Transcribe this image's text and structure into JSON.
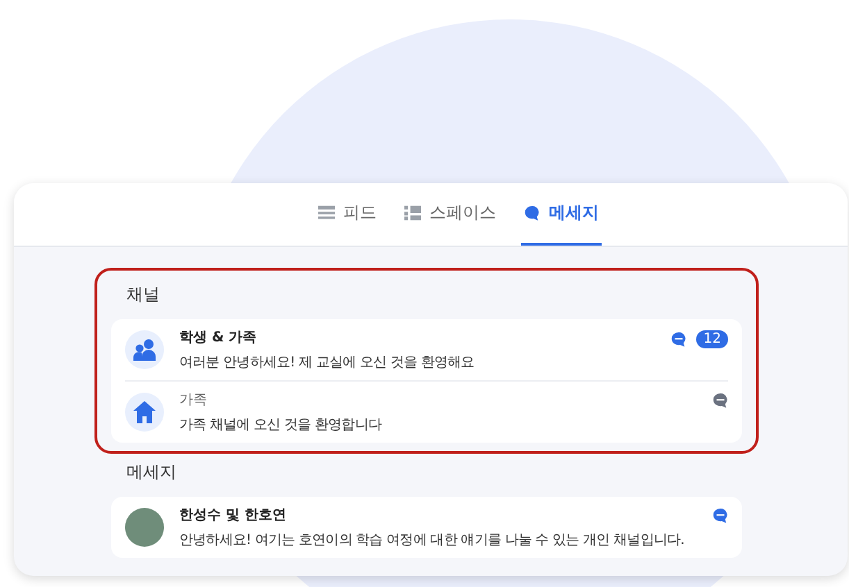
{
  "tabs": [
    {
      "label": "피드",
      "kind": "feed",
      "selected": false
    },
    {
      "label": "스페이스",
      "kind": "spaces",
      "selected": false
    },
    {
      "label": "메세지",
      "kind": "chat",
      "selected": true
    }
  ],
  "channels": {
    "heading": "채널",
    "highlighted": true,
    "items": [
      {
        "kind": "group",
        "title": "학생 & 가족",
        "preview": "여러분 안녕하세요! 제 교실에 오신 것을 환영해요",
        "unread": true,
        "count": "12"
      },
      {
        "kind": "home",
        "title": "가족",
        "preview": "가족 채널에 오신 것을 환영합니다",
        "unread": false
      }
    ]
  },
  "messages": {
    "heading": "메세지",
    "items": [
      {
        "title": "한성수 및 한호연",
        "preview": "안녕하세요! 여기는 호연이의 학습 여정에 대한 얘기를 나눌 수 있는 개인 채널입니다.",
        "unread": true
      }
    ]
  }
}
